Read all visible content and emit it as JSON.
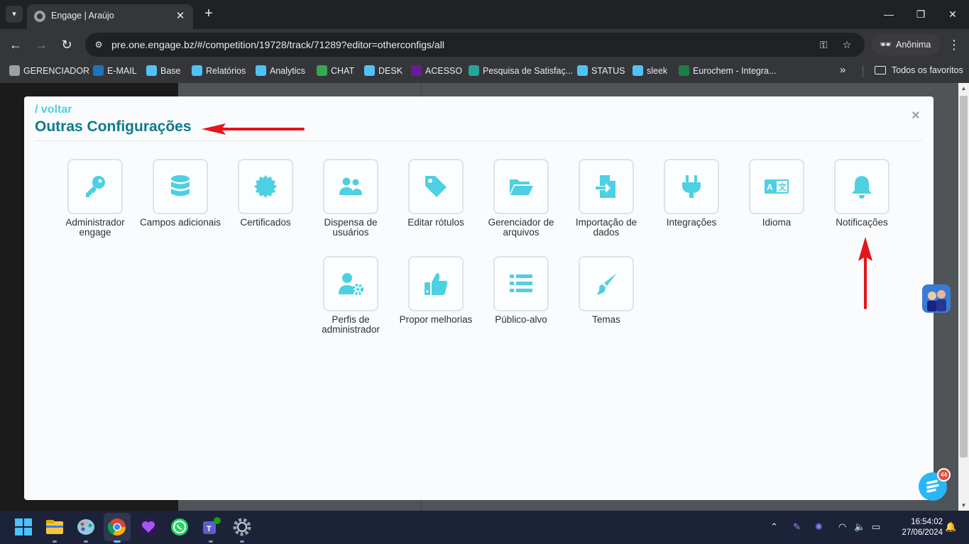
{
  "browser": {
    "tab_title": "Engage | Araújo",
    "url": "pre.one.engage.bz/#/competition/19728/track/71289?editor=otherconfigs/all",
    "profile_label": "Anônima",
    "bookmarks": [
      {
        "label": "GERENCIADOR",
        "color": "#9aa0a6"
      },
      {
        "label": "E-MAIL",
        "color": "#1e73be"
      },
      {
        "label": "Base",
        "color": "#4fc3f7"
      },
      {
        "label": "Relatórios",
        "color": "#4fc3f7"
      },
      {
        "label": "Analytics",
        "color": "#4fc3f7"
      },
      {
        "label": "CHAT",
        "color": "#34a853"
      },
      {
        "label": "DESK",
        "color": "#4fc3f7"
      },
      {
        "label": "ACESSO",
        "color": "#6a1b9a"
      },
      {
        "label": "Pesquisa de Satisfaç...",
        "color": "#26a69a"
      },
      {
        "label": "STATUS",
        "color": "#4fc3f7"
      },
      {
        "label": "sleek",
        "color": "#4fc3f7"
      },
      {
        "label": "Eurochem - Integra...",
        "color": "#1e7e45"
      }
    ],
    "all_bookmarks_label": "Todos os favoritos"
  },
  "modal": {
    "back_link": "/ voltar",
    "title": "Outras Configurações",
    "close_symbol": "×",
    "accent_color": "#4dd0e1",
    "tiles_row1": [
      {
        "label": "Administrador engage",
        "icon": "key-icon"
      },
      {
        "label": "Campos adicionais",
        "icon": "database-icon"
      },
      {
        "label": "Certificados",
        "icon": "certificate-icon"
      },
      {
        "label": "Dispensa de usuários",
        "icon": "users-icon"
      },
      {
        "label": "Editar rótulos",
        "icon": "tag-icon"
      },
      {
        "label": "Gerenciador de arquivos",
        "icon": "folder-open-icon"
      },
      {
        "label": "Importação de dados",
        "icon": "file-import-icon"
      },
      {
        "label": "Integrações",
        "icon": "plug-icon"
      },
      {
        "label": "Idioma",
        "icon": "language-icon"
      },
      {
        "label": "Notificações",
        "icon": "bell-icon"
      }
    ],
    "tiles_row2": [
      {
        "label": "Perfis de administrador",
        "icon": "user-cog-icon"
      },
      {
        "label": "Propor melhorias",
        "icon": "thumbs-up-icon"
      },
      {
        "label": "Público-alvo",
        "icon": "list-icon"
      },
      {
        "label": "Temas",
        "icon": "paint-brush-icon"
      }
    ]
  },
  "chat_widget": {
    "badge": "44"
  },
  "taskbar": {
    "time": "16:54:02",
    "date": "27/06/2024"
  }
}
